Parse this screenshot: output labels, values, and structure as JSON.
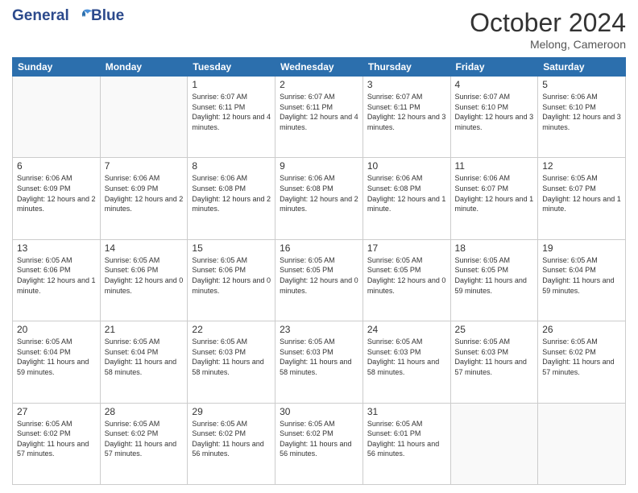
{
  "header": {
    "logo_line1": "General",
    "logo_line2": "Blue",
    "month": "October 2024",
    "location": "Melong, Cameroon"
  },
  "weekdays": [
    "Sunday",
    "Monday",
    "Tuesday",
    "Wednesday",
    "Thursday",
    "Friday",
    "Saturday"
  ],
  "weeks": [
    [
      {
        "day": "",
        "sunrise": "",
        "sunset": "",
        "daylight": ""
      },
      {
        "day": "",
        "sunrise": "",
        "sunset": "",
        "daylight": ""
      },
      {
        "day": "1",
        "sunrise": "Sunrise: 6:07 AM",
        "sunset": "Sunset: 6:11 PM",
        "daylight": "Daylight: 12 hours and 4 minutes."
      },
      {
        "day": "2",
        "sunrise": "Sunrise: 6:07 AM",
        "sunset": "Sunset: 6:11 PM",
        "daylight": "Daylight: 12 hours and 4 minutes."
      },
      {
        "day": "3",
        "sunrise": "Sunrise: 6:07 AM",
        "sunset": "Sunset: 6:11 PM",
        "daylight": "Daylight: 12 hours and 3 minutes."
      },
      {
        "day": "4",
        "sunrise": "Sunrise: 6:07 AM",
        "sunset": "Sunset: 6:10 PM",
        "daylight": "Daylight: 12 hours and 3 minutes."
      },
      {
        "day": "5",
        "sunrise": "Sunrise: 6:06 AM",
        "sunset": "Sunset: 6:10 PM",
        "daylight": "Daylight: 12 hours and 3 minutes."
      }
    ],
    [
      {
        "day": "6",
        "sunrise": "Sunrise: 6:06 AM",
        "sunset": "Sunset: 6:09 PM",
        "daylight": "Daylight: 12 hours and 2 minutes."
      },
      {
        "day": "7",
        "sunrise": "Sunrise: 6:06 AM",
        "sunset": "Sunset: 6:09 PM",
        "daylight": "Daylight: 12 hours and 2 minutes."
      },
      {
        "day": "8",
        "sunrise": "Sunrise: 6:06 AM",
        "sunset": "Sunset: 6:08 PM",
        "daylight": "Daylight: 12 hours and 2 minutes."
      },
      {
        "day": "9",
        "sunrise": "Sunrise: 6:06 AM",
        "sunset": "Sunset: 6:08 PM",
        "daylight": "Daylight: 12 hours and 2 minutes."
      },
      {
        "day": "10",
        "sunrise": "Sunrise: 6:06 AM",
        "sunset": "Sunset: 6:08 PM",
        "daylight": "Daylight: 12 hours and 1 minute."
      },
      {
        "day": "11",
        "sunrise": "Sunrise: 6:06 AM",
        "sunset": "Sunset: 6:07 PM",
        "daylight": "Daylight: 12 hours and 1 minute."
      },
      {
        "day": "12",
        "sunrise": "Sunrise: 6:05 AM",
        "sunset": "Sunset: 6:07 PM",
        "daylight": "Daylight: 12 hours and 1 minute."
      }
    ],
    [
      {
        "day": "13",
        "sunrise": "Sunrise: 6:05 AM",
        "sunset": "Sunset: 6:06 PM",
        "daylight": "Daylight: 12 hours and 1 minute."
      },
      {
        "day": "14",
        "sunrise": "Sunrise: 6:05 AM",
        "sunset": "Sunset: 6:06 PM",
        "daylight": "Daylight: 12 hours and 0 minutes."
      },
      {
        "day": "15",
        "sunrise": "Sunrise: 6:05 AM",
        "sunset": "Sunset: 6:06 PM",
        "daylight": "Daylight: 12 hours and 0 minutes."
      },
      {
        "day": "16",
        "sunrise": "Sunrise: 6:05 AM",
        "sunset": "Sunset: 6:05 PM",
        "daylight": "Daylight: 12 hours and 0 minutes."
      },
      {
        "day": "17",
        "sunrise": "Sunrise: 6:05 AM",
        "sunset": "Sunset: 6:05 PM",
        "daylight": "Daylight: 12 hours and 0 minutes."
      },
      {
        "day": "18",
        "sunrise": "Sunrise: 6:05 AM",
        "sunset": "Sunset: 6:05 PM",
        "daylight": "Daylight: 11 hours and 59 minutes."
      },
      {
        "day": "19",
        "sunrise": "Sunrise: 6:05 AM",
        "sunset": "Sunset: 6:04 PM",
        "daylight": "Daylight: 11 hours and 59 minutes."
      }
    ],
    [
      {
        "day": "20",
        "sunrise": "Sunrise: 6:05 AM",
        "sunset": "Sunset: 6:04 PM",
        "daylight": "Daylight: 11 hours and 59 minutes."
      },
      {
        "day": "21",
        "sunrise": "Sunrise: 6:05 AM",
        "sunset": "Sunset: 6:04 PM",
        "daylight": "Daylight: 11 hours and 58 minutes."
      },
      {
        "day": "22",
        "sunrise": "Sunrise: 6:05 AM",
        "sunset": "Sunset: 6:03 PM",
        "daylight": "Daylight: 11 hours and 58 minutes."
      },
      {
        "day": "23",
        "sunrise": "Sunrise: 6:05 AM",
        "sunset": "Sunset: 6:03 PM",
        "daylight": "Daylight: 11 hours and 58 minutes."
      },
      {
        "day": "24",
        "sunrise": "Sunrise: 6:05 AM",
        "sunset": "Sunset: 6:03 PM",
        "daylight": "Daylight: 11 hours and 58 minutes."
      },
      {
        "day": "25",
        "sunrise": "Sunrise: 6:05 AM",
        "sunset": "Sunset: 6:03 PM",
        "daylight": "Daylight: 11 hours and 57 minutes."
      },
      {
        "day": "26",
        "sunrise": "Sunrise: 6:05 AM",
        "sunset": "Sunset: 6:02 PM",
        "daylight": "Daylight: 11 hours and 57 minutes."
      }
    ],
    [
      {
        "day": "27",
        "sunrise": "Sunrise: 6:05 AM",
        "sunset": "Sunset: 6:02 PM",
        "daylight": "Daylight: 11 hours and 57 minutes."
      },
      {
        "day": "28",
        "sunrise": "Sunrise: 6:05 AM",
        "sunset": "Sunset: 6:02 PM",
        "daylight": "Daylight: 11 hours and 57 minutes."
      },
      {
        "day": "29",
        "sunrise": "Sunrise: 6:05 AM",
        "sunset": "Sunset: 6:02 PM",
        "daylight": "Daylight: 11 hours and 56 minutes."
      },
      {
        "day": "30",
        "sunrise": "Sunrise: 6:05 AM",
        "sunset": "Sunset: 6:02 PM",
        "daylight": "Daylight: 11 hours and 56 minutes."
      },
      {
        "day": "31",
        "sunrise": "Sunrise: 6:05 AM",
        "sunset": "Sunset: 6:01 PM",
        "daylight": "Daylight: 11 hours and 56 minutes."
      },
      {
        "day": "",
        "sunrise": "",
        "sunset": "",
        "daylight": ""
      },
      {
        "day": "",
        "sunrise": "",
        "sunset": "",
        "daylight": ""
      }
    ]
  ]
}
